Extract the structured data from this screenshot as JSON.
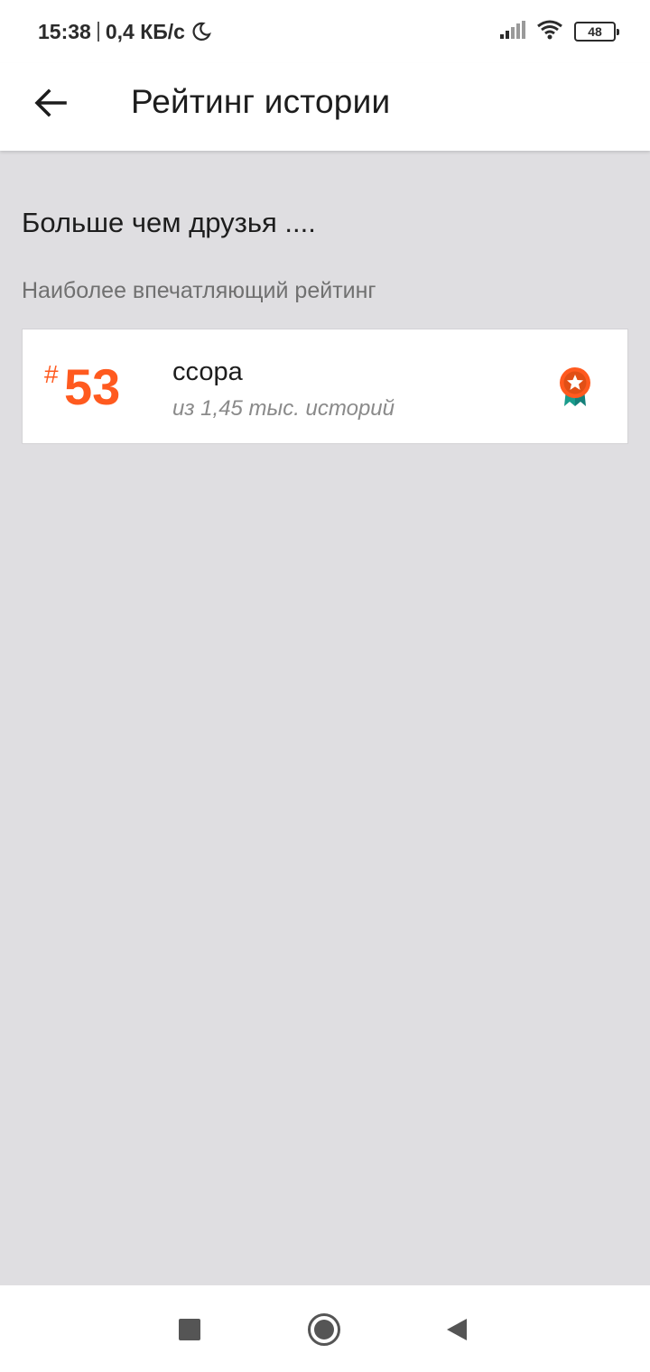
{
  "status_bar": {
    "time": "15:38",
    "speed": "0,4 КБ/с",
    "battery": "48",
    "icons": [
      "moon-icon",
      "signal-icon",
      "wifi-icon",
      "battery-icon"
    ]
  },
  "app_bar": {
    "title": "Рейтинг истории",
    "back_icon": "arrow-left-icon"
  },
  "content": {
    "heading": "Больше чем друзья ....",
    "subheading": "Наиболее впечатляющий рейтинг",
    "rating": {
      "hash": "#",
      "rank": "53",
      "tag": "ссора",
      "count": "из 1,45 тыс. историй",
      "icon": "award-badge-icon"
    }
  },
  "nav_bar": {
    "icons": [
      "recent-apps-icon",
      "home-icon",
      "back-triangle-icon"
    ]
  },
  "colors": {
    "accent": "#ff5a1f",
    "background": "#dfdee1",
    "badge_ribbon": "#1a9c8c"
  }
}
